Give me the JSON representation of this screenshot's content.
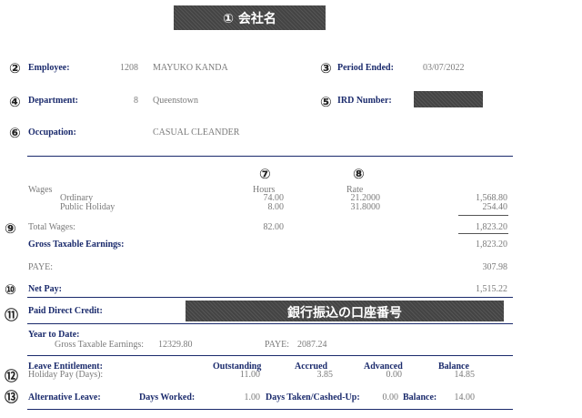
{
  "header": {
    "company_name": "① 会社名"
  },
  "markers": {
    "m2": "②",
    "m3": "③",
    "m4": "④",
    "m5": "⑤",
    "m6": "⑥",
    "m7": "⑦",
    "m8": "⑧",
    "m9": "⑨",
    "m10": "⑩",
    "m11": "⑪",
    "m12": "⑫",
    "m13": "⑬"
  },
  "employee": {
    "label": "Employee:",
    "number": "1208",
    "name": "MAYUKO KANDA",
    "period_label": "Period Ended:",
    "period_value": "03/07/2022",
    "department_label": "Department:",
    "department_number": "8",
    "department_name": "Queenstown",
    "ird_label": "IRD Number:",
    "occupation_label": "Occupation:",
    "occupation_value": "CASUAL CLEANDER"
  },
  "earnings": {
    "hours_header": "Hours",
    "rate_header": "Rate",
    "wages_label": "Wages",
    "rows": [
      {
        "label": "Ordinary",
        "hours": "74.00",
        "rate": "21.2000",
        "amount": "1,568.80"
      },
      {
        "label": "Public Holiday",
        "hours": "8.00",
        "rate": "31.8000",
        "amount": "254.40"
      }
    ],
    "total_label": "Total Wages:",
    "total_hours": "82.00",
    "total_amount": "1,823.20",
    "gross_label": "Gross Taxable Earnings:",
    "gross_amount": "1,823.20",
    "paye_label": "PAYE:",
    "paye_amount": "307.98",
    "net_label": "Net Pay:",
    "net_amount": "1,515.22"
  },
  "bank": {
    "label": "Paid Direct Credit:",
    "account_placeholder": "銀行振込の口座番号"
  },
  "ytd": {
    "label": "Year to Date:",
    "gross_label": "Gross Taxable Earnings:",
    "gross_value": "12329.80",
    "paye_label": "PAYE:",
    "paye_value": "2087.24"
  },
  "leave": {
    "label": "Leave Entitlement:",
    "col_outstanding": "Outstanding",
    "col_accrued": "Accrued",
    "col_advanced": "Advanced",
    "col_balance": "Balance",
    "holiday_label": "Holiday Pay (Days):",
    "holiday_outstanding": "11.00",
    "holiday_accrued": "3.85",
    "holiday_advanced": "0.00",
    "holiday_balance": "14.85",
    "alt_label": "Alternative Leave:",
    "days_worked_label": "Days Worked:",
    "days_worked_value": "1.00",
    "days_taken_label": "Days Taken/Cashed-Up:",
    "days_taken_value": "0.00",
    "alt_balance_label": "Balance:",
    "alt_balance_value": "14.00"
  }
}
